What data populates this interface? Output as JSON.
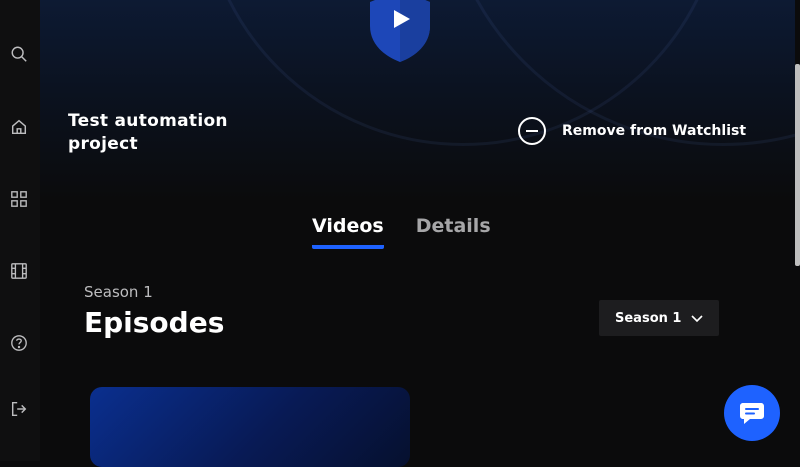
{
  "sidebar": {
    "items": [
      {
        "icon": "search-icon"
      },
      {
        "icon": "home-icon"
      },
      {
        "icon": "grid-icon"
      },
      {
        "icon": "film-icon"
      },
      {
        "icon": "help-icon"
      },
      {
        "icon": "logout-icon"
      }
    ]
  },
  "project": {
    "title": "Test automation project"
  },
  "watchlist": {
    "label": "Remove from Watchlist"
  },
  "tabs": [
    {
      "label": "Videos",
      "active": true
    },
    {
      "label": "Details",
      "active": false
    }
  ],
  "section": {
    "subtitle": "Season 1",
    "title": "Episodes"
  },
  "season_select": {
    "value": "Season 1"
  },
  "colors": {
    "accent": "#1e62ff",
    "background": "#0b0b0c"
  }
}
